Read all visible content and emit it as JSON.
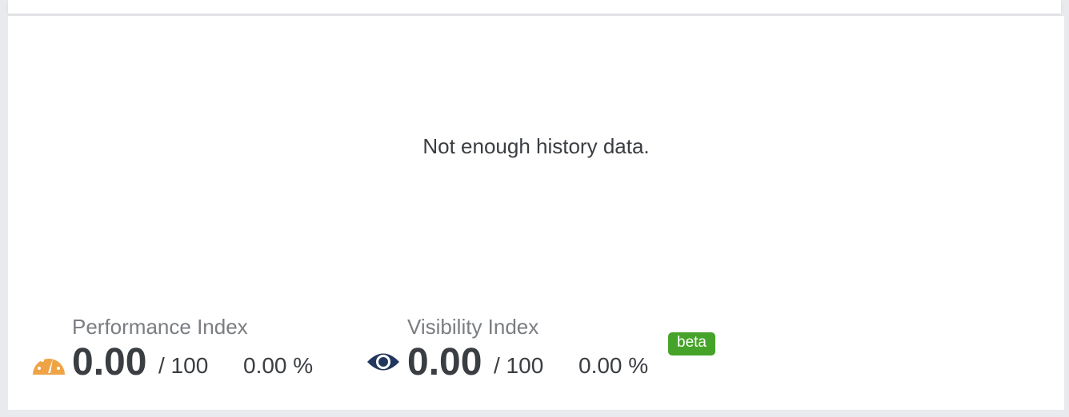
{
  "message": "Not enough history data.",
  "performance": {
    "label": "Performance Index",
    "value": "0.00",
    "out_of": "/ 100",
    "percent": "0.00 %",
    "icon": "speedometer-icon",
    "color": "#eea345"
  },
  "visibility": {
    "label": "Visibility Index",
    "value": "0.00",
    "out_of": "/ 100",
    "percent": "0.00 %",
    "icon": "eye-icon",
    "color": "#22375e",
    "badge": "beta",
    "badge_color": "#46a32a"
  }
}
